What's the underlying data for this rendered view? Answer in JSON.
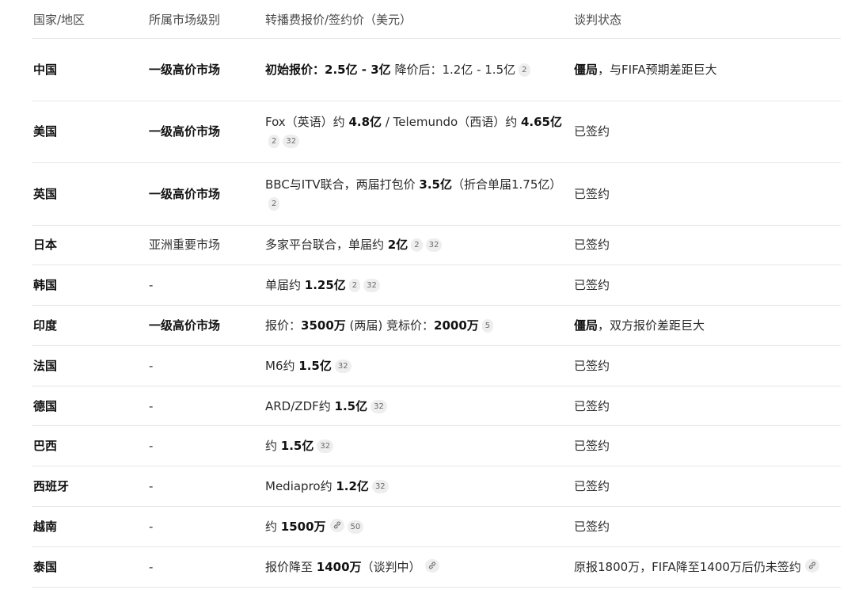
{
  "headers": {
    "country": "国家/地区",
    "market": "所属市场级别",
    "price": "转播费报价/签约价（美元）",
    "status": "谈判状态"
  },
  "rows": [
    {
      "country": "中国",
      "market": "一级高价市场",
      "market_bold": true,
      "price": [
        {
          "t": "初始报价：2.5亿 - 3亿",
          "b": true
        },
        {
          "t": " 降价后：1.2亿 - 1.5亿"
        },
        {
          "c": "2"
        }
      ],
      "status": [
        {
          "t": "僵局",
          "b": true
        },
        {
          "t": "，与FIFA预期差距巨大"
        }
      ]
    },
    {
      "country": "美国",
      "market": "一级高价市场",
      "market_bold": true,
      "price": [
        {
          "t": "Fox（英语）约 "
        },
        {
          "t": "4.8亿",
          "b": true
        },
        {
          "t": " / Telemundo（西语）约 "
        },
        {
          "t": "4.65亿",
          "b": true
        },
        {
          "c": "2"
        },
        {
          "c": "32"
        }
      ],
      "status": [
        {
          "t": "已签约"
        }
      ]
    },
    {
      "country": "英国",
      "market": "一级高价市场",
      "market_bold": true,
      "price": [
        {
          "t": "BBC与ITV联合，两届打包价 "
        },
        {
          "t": "3.5亿",
          "b": true
        },
        {
          "t": "（折合单届1.75亿）"
        },
        {
          "c": "2"
        }
      ],
      "status": [
        {
          "t": "已签约"
        }
      ]
    },
    {
      "country": "日本",
      "market": "亚洲重要市场",
      "market_bold": false,
      "price": [
        {
          "t": "多家平台联合，单届约 "
        },
        {
          "t": "2亿",
          "b": true
        },
        {
          "c": "2"
        },
        {
          "c": "32"
        }
      ],
      "status": [
        {
          "t": "已签约"
        }
      ]
    },
    {
      "country": "韩国",
      "market": "-",
      "market_bold": false,
      "price": [
        {
          "t": "单届约 "
        },
        {
          "t": "1.25亿",
          "b": true
        },
        {
          "c": "2"
        },
        {
          "c": "32"
        }
      ],
      "status": [
        {
          "t": "已签约"
        }
      ]
    },
    {
      "country": "印度",
      "market": "一级高价市场",
      "market_bold": true,
      "price": [
        {
          "t": "报价："
        },
        {
          "t": "3500万",
          "b": true
        },
        {
          "t": " (两届) 竞标价："
        },
        {
          "t": "2000万",
          "b": true
        },
        {
          "c": "5"
        }
      ],
      "status": [
        {
          "t": "僵局",
          "b": true
        },
        {
          "t": "，双方报价差距巨大"
        }
      ]
    },
    {
      "country": "法国",
      "market": "-",
      "market_bold": false,
      "price": [
        {
          "t": "M6约 "
        },
        {
          "t": "1.5亿",
          "b": true
        },
        {
          "c": "32"
        }
      ],
      "status": [
        {
          "t": "已签约"
        }
      ]
    },
    {
      "country": "德国",
      "market": "-",
      "market_bold": false,
      "price": [
        {
          "t": "ARD/ZDF约 "
        },
        {
          "t": "1.5亿",
          "b": true
        },
        {
          "c": "32"
        }
      ],
      "status": [
        {
          "t": "已签约"
        }
      ]
    },
    {
      "country": "巴西",
      "market": "-",
      "market_bold": false,
      "price": [
        {
          "t": "约 "
        },
        {
          "t": "1.5亿",
          "b": true
        },
        {
          "c": "32"
        }
      ],
      "status": [
        {
          "t": "已签约"
        }
      ]
    },
    {
      "country": "西班牙",
      "market": "-",
      "market_bold": false,
      "price": [
        {
          "t": "Mediapro约 "
        },
        {
          "t": "1.2亿",
          "b": true
        },
        {
          "c": "32"
        }
      ],
      "status": [
        {
          "t": "已签约"
        }
      ]
    },
    {
      "country": "越南",
      "market": "-",
      "market_bold": false,
      "price": [
        {
          "t": "约 "
        },
        {
          "t": "1500万",
          "b": true
        },
        {
          "i": "link-icon"
        },
        {
          "c": "50"
        }
      ],
      "status": [
        {
          "t": "已签约"
        }
      ]
    },
    {
      "country": "泰国",
      "market": "-",
      "market_bold": false,
      "price": [
        {
          "t": "报价降至 "
        },
        {
          "t": "1400万",
          "b": true
        },
        {
          "t": "（谈判中）"
        },
        {
          "i": "link-icon"
        }
      ],
      "status": [
        {
          "t": "原报1800万，FIFA降至1400万后仍未签约"
        },
        {
          "i": "link-icon"
        }
      ]
    }
  ]
}
